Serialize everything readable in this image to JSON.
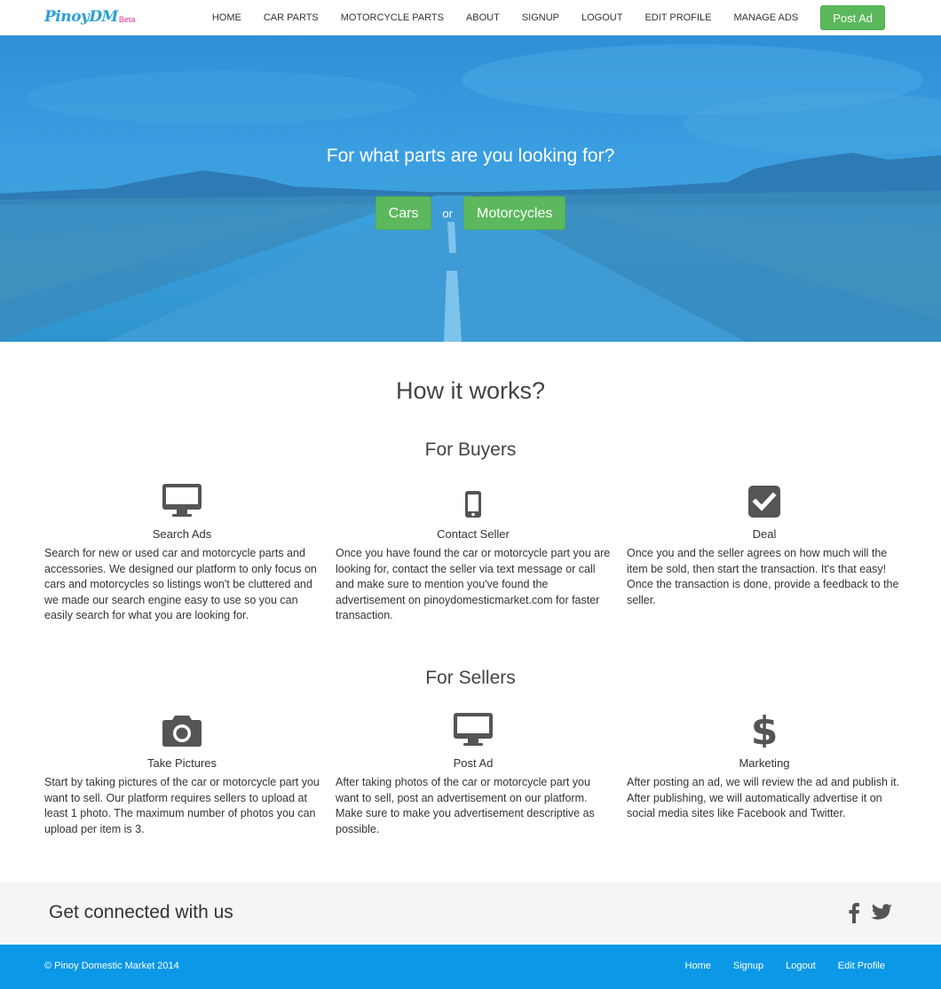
{
  "brand": {
    "name": "PinoyDM",
    "beta": "Beta"
  },
  "nav": {
    "links": [
      "HOME",
      "CAR PARTS",
      "MOTORCYCLE PARTS",
      "ABOUT",
      "SIGNUP",
      "LOGOUT",
      "EDIT PROFILE",
      "MANAGE ADS"
    ],
    "post_ad": "Post Ad"
  },
  "hero": {
    "title": "For what parts are you looking for?",
    "cars_button": "Cars",
    "or_text": "or",
    "motorcycles_button": "Motorcycles"
  },
  "how": {
    "title": "How it works?",
    "buyers": {
      "title": "For Buyers",
      "items": [
        {
          "icon": "desktop-icon",
          "title": "Search Ads",
          "desc": "Search for new or used car and motorcycle parts and accessories. We designed our platform to only focus on cars and motorcycles so listings won't be cluttered and we made our search engine easy to use so you can easily search for what you are looking for."
        },
        {
          "icon": "mobile-phone-icon",
          "title": "Contact Seller",
          "desc": "Once you have found the car or motorcycle part you are looking for, contact the seller via text message or call and make sure to mention you've found the advertisement on pinoydomesticmarket.com for faster transaction."
        },
        {
          "icon": "checkbox-checked-icon",
          "title": "Deal",
          "desc": "Once you and the seller agrees on how much will the item be sold, then start the transaction. It's that easy! Once the transaction is done, provide a feedback to the seller."
        }
      ]
    },
    "sellers": {
      "title": "For Sellers",
      "items": [
        {
          "icon": "camera-icon",
          "title": "Take Pictures",
          "desc": "Start by taking pictures of the car or motorcycle part you want to sell. Our platform requires sellers to upload at least 1 photo. The maximum number of photos you can upload per item is 3."
        },
        {
          "icon": "desktop-icon",
          "title": "Post Ad",
          "desc": "After taking photos of the car or motorcycle part you want to sell, post an advertisement on our platform. Make sure to make you advertisement descriptive as possible."
        },
        {
          "icon": "dollar-icon",
          "title": "Marketing",
          "desc": "After posting an ad, we will review the ad and publish it. After publishing, we will automatically advertise it on social media sites like Facebook and Twitter."
        }
      ]
    }
  },
  "connect": {
    "text": "Get connected with us",
    "icons": [
      "facebook-icon",
      "twitter-icon"
    ]
  },
  "footer": {
    "copyright": "© Pinoy Domestic Market 2014",
    "links": [
      "Home",
      "Signup",
      "Logout",
      "Edit Profile"
    ]
  },
  "colors": {
    "primary": "#0b98e6",
    "button": "#5cb85c",
    "brand": "#2a9fd6",
    "beta": "#e0338a",
    "icon": "#555555"
  }
}
